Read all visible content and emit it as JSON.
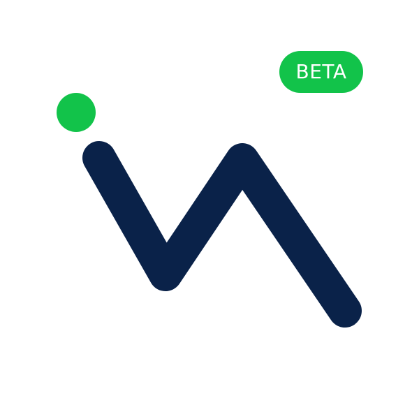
{
  "logo": {
    "name": "logo-mark",
    "stroke_color": "#0a2249",
    "dot_color": "#12c34a"
  },
  "badge": {
    "label": "BETA",
    "background_color": "#12c34a",
    "text_color": "#ffffff"
  }
}
